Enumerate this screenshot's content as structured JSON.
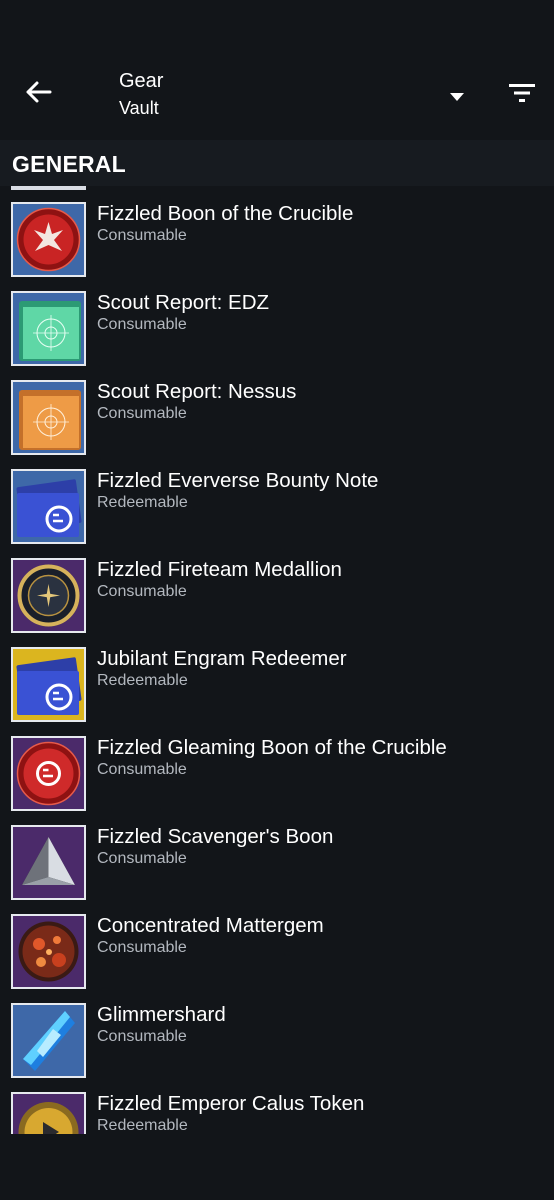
{
  "header": {
    "title": "Gear",
    "subtitle": "Vault",
    "back_icon": "arrow-left-icon",
    "dropdown_icon": "caret-down-icon",
    "filter_icon": "filter-icon"
  },
  "section": {
    "title": "GENERAL"
  },
  "colors": {
    "background": "#121519",
    "section_background": "#171b20",
    "text_primary": "#ffffff",
    "text_secondary": "#b3b8bf",
    "thumb_border": "#e6e9ee"
  },
  "items": [
    {
      "name": "Fizzled Boon of the Crucible",
      "type": "Consumable",
      "icon": "crucible-boon-icon"
    },
    {
      "name": "Scout Report: EDZ",
      "type": "Consumable",
      "icon": "scout-report-green-icon"
    },
    {
      "name": "Scout Report: Nessus",
      "type": "Consumable",
      "icon": "scout-report-orange-icon"
    },
    {
      "name": "Fizzled Eververse Bounty Note",
      "type": "Redeemable",
      "icon": "eververse-note-icon"
    },
    {
      "name": "Fizzled Fireteam Medallion",
      "type": "Consumable",
      "icon": "fireteam-medallion-icon"
    },
    {
      "name": "Jubilant Engram Redeemer",
      "type": "Redeemable",
      "icon": "engram-redeemer-icon"
    },
    {
      "name": "Fizzled Gleaming Boon of the Crucible",
      "type": "Consumable",
      "icon": "gleaming-boon-icon"
    },
    {
      "name": "Fizzled Scavenger's Boon",
      "type": "Consumable",
      "icon": "scavenger-boon-icon"
    },
    {
      "name": "Concentrated Mattergem",
      "type": "Consumable",
      "icon": "mattergem-icon"
    },
    {
      "name": "Glimmershard",
      "type": "Consumable",
      "icon": "glimmershard-icon"
    },
    {
      "name": "Fizzled Emperor Calus Token",
      "type": "Redeemable",
      "icon": "calus-token-icon"
    }
  ]
}
